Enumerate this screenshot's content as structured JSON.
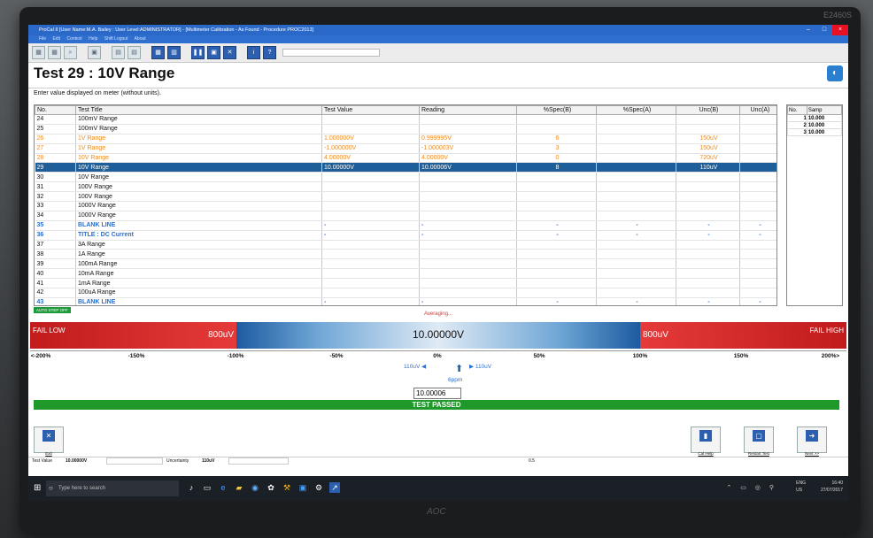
{
  "monitor": {
    "model": "E2460S",
    "brand": "AOC"
  },
  "window": {
    "title": "ProCal II [User Name:M.A. Bailey : User Level:ADMINISTRATOR] - [Multimeter Calibration - As Found - Procedure PROC2013]",
    "menu": [
      "File",
      "Edit",
      "Context",
      "Help",
      "Shift Logout",
      "About"
    ]
  },
  "test": {
    "heading": "Test 29 : 10V Range",
    "instruction": "Enter value displayed on meter (without units)."
  },
  "table": {
    "columns": [
      "No.",
      "Test Title",
      "Test Value",
      "Reading",
      "%Spec(B)",
      "%Spec(A)",
      "Unc(B)",
      "Unc(A)"
    ],
    "rows": [
      {
        "no": "24",
        "title": "100mV Range",
        "value": "",
        "reading": "",
        "specb": "",
        "speca": "",
        "uncb": "",
        "unca": "",
        "style": ""
      },
      {
        "no": "25",
        "title": "100mV Range",
        "value": "",
        "reading": "",
        "specb": "",
        "speca": "",
        "uncb": "",
        "unca": "",
        "style": ""
      },
      {
        "no": "26",
        "title": "1V Range",
        "value": "1.000000V",
        "reading": "0.999995V",
        "specb": "6",
        "speca": "",
        "uncb": "150uV",
        "unca": "",
        "style": "orange"
      },
      {
        "no": "27",
        "title": "1V Range",
        "value": "-1.000000V",
        "reading": "-1.000003V",
        "specb": "3",
        "speca": "",
        "uncb": "150uV",
        "unca": "",
        "style": "orange"
      },
      {
        "no": "28",
        "title": "10V Range",
        "value": "4.00000V",
        "reading": "4.00000V",
        "specb": "0",
        "speca": "",
        "uncb": "720uV",
        "unca": "",
        "style": "orange"
      },
      {
        "no": "29",
        "title": "10V Range",
        "value": "10.00000V",
        "reading": "10.00006V",
        "specb": "8",
        "speca": "",
        "uncb": "110uV",
        "unca": "",
        "style": "sel"
      },
      {
        "no": "30",
        "title": "10V Range",
        "value": "",
        "reading": "",
        "specb": "",
        "speca": "",
        "uncb": "",
        "unca": "",
        "style": ""
      },
      {
        "no": "31",
        "title": "100V Range",
        "value": "",
        "reading": "",
        "specb": "",
        "speca": "",
        "uncb": "",
        "unca": "",
        "style": ""
      },
      {
        "no": "32",
        "title": "100V Range",
        "value": "",
        "reading": "",
        "specb": "",
        "speca": "",
        "uncb": "",
        "unca": "",
        "style": ""
      },
      {
        "no": "33",
        "title": "1000V Range",
        "value": "",
        "reading": "",
        "specb": "",
        "speca": "",
        "uncb": "",
        "unca": "",
        "style": ""
      },
      {
        "no": "34",
        "title": "1000V Range",
        "value": "",
        "reading": "",
        "specb": "",
        "speca": "",
        "uncb": "",
        "unca": "",
        "style": ""
      },
      {
        "no": "35",
        "title": "BLANK LINE",
        "value": "-",
        "reading": "-",
        "specb": "-",
        "speca": "-",
        "uncb": "-",
        "unca": "-",
        "style": "blueline"
      },
      {
        "no": "36",
        "title": "TITLE : DC Current",
        "value": "-",
        "reading": "-",
        "specb": "-",
        "speca": "-",
        "uncb": "-",
        "unca": "-",
        "style": "blueline"
      },
      {
        "no": "37",
        "title": "3A Range",
        "value": "",
        "reading": "",
        "specb": "",
        "speca": "",
        "uncb": "",
        "unca": "",
        "style": ""
      },
      {
        "no": "38",
        "title": "1A Range",
        "value": "",
        "reading": "",
        "specb": "",
        "speca": "",
        "uncb": "",
        "unca": "",
        "style": ""
      },
      {
        "no": "39",
        "title": "100mA Range",
        "value": "",
        "reading": "",
        "specb": "",
        "speca": "",
        "uncb": "",
        "unca": "",
        "style": ""
      },
      {
        "no": "40",
        "title": "10mA Range",
        "value": "",
        "reading": "",
        "specb": "",
        "speca": "",
        "uncb": "",
        "unca": "",
        "style": ""
      },
      {
        "no": "41",
        "title": "1mA Range",
        "value": "",
        "reading": "",
        "specb": "",
        "speca": "",
        "uncb": "",
        "unca": "",
        "style": ""
      },
      {
        "no": "42",
        "title": "100uA Range",
        "value": "",
        "reading": "",
        "specb": "",
        "speca": "",
        "uncb": "",
        "unca": "",
        "style": ""
      },
      {
        "no": "43",
        "title": "BLANK LINE",
        "value": "-",
        "reading": "-",
        "specb": "-",
        "speca": "-",
        "uncb": "-",
        "unca": "-",
        "style": "blueline"
      }
    ]
  },
  "samples": {
    "columns": [
      "No.",
      "Samp"
    ],
    "rows": [
      [
        "1",
        "10.000"
      ],
      [
        "2",
        "10.000"
      ],
      [
        "3",
        "10.000"
      ]
    ]
  },
  "status": {
    "auto_step": "AUTO STEP OFF",
    "averaging": "Averaging..."
  },
  "gauge": {
    "fail_low": "FAIL LOW",
    "fail_high": "FAIL HIGH",
    "limit_low": "800uV",
    "limit_high": "800uV",
    "value": "10.00000V",
    "scale": [
      "<-200%",
      "-150%",
      "-100%",
      "-50%",
      "0%",
      "50%",
      "100%",
      "150%",
      "200%>"
    ],
    "unc_left": "110uV",
    "unc_right": "110uV",
    "ppm": "6ppm",
    "reading_input": "10.00006",
    "result": "TEST PASSED",
    "colors": {
      "fail": "#d42525",
      "pass": "#1f9a2a",
      "accent": "#1f5f99"
    }
  },
  "buttons": {
    "exit": "Exit",
    "cal_help": "Cal Help",
    "restart_test": "Restart Test",
    "next": "Next >>"
  },
  "infobar": {
    "test_value_label": "Test Value",
    "test_value": "10.00000V",
    "uncertainty_label": "Uncertainty",
    "uncertainty": "110uV",
    "mid_value": "0.5"
  },
  "taskbar": {
    "search_placeholder": "Type here to search",
    "lang": "ENG",
    "region": "US",
    "time": "16:40",
    "date": "27/07/2017"
  }
}
